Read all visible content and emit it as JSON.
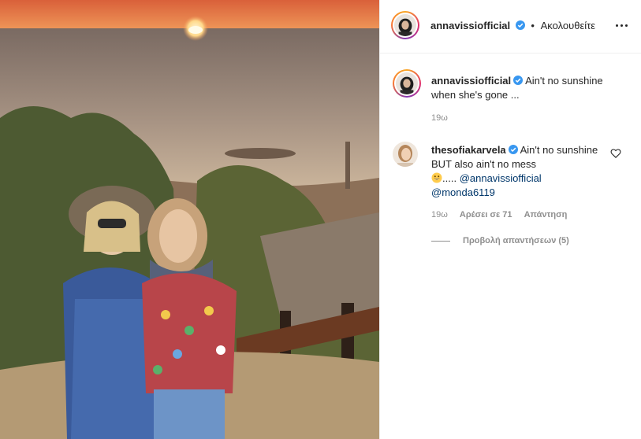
{
  "post": {
    "author": "annavissiofficial",
    "follow_separator": "•",
    "follow_label": "Ακολουθείτε",
    "more_icon": "more-horizontal-icon"
  },
  "caption": {
    "username": "annavissiofficial",
    "text": "Ain't no sunshine when she's gone ...",
    "time": "19ω"
  },
  "comment": {
    "username": "thesofiakarvela",
    "text": "Ain't no sunshine BUT also ain't no mess",
    "suffix": ".....",
    "mention_1": "@annavissiofficial",
    "mention_2": "@monda6119",
    "time": "19ω",
    "likes": "Αρέσει σε 71",
    "reply": "Απάντηση",
    "heart_icon": "heart-outline-icon"
  },
  "replies": {
    "label": "Προβολή απαντήσεων (5)"
  },
  "colors": {
    "verified": "#3897f0",
    "mention": "#00376b",
    "muted": "#8e8e8e",
    "text": "#262626"
  }
}
